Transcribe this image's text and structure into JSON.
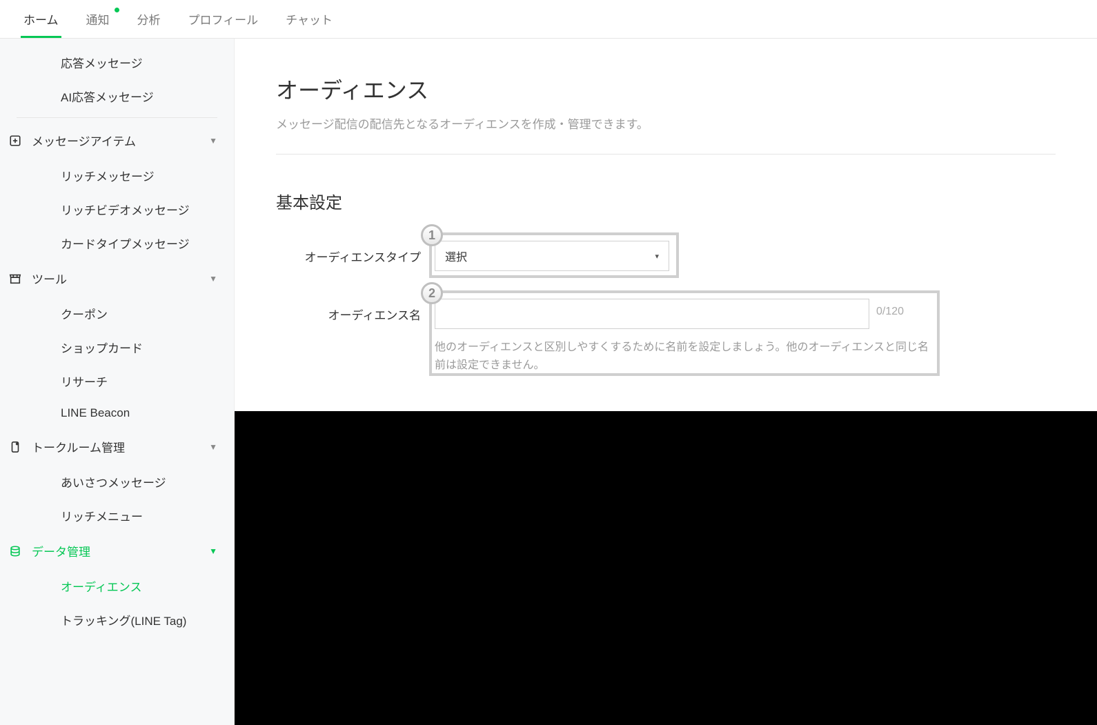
{
  "tabs": {
    "home": "ホーム",
    "notifications": "通知",
    "analytics": "分析",
    "profile": "プロフィール",
    "chat": "チャット"
  },
  "sidebar": {
    "reply_msg": "応答メッセージ",
    "ai_reply_msg": "AI応答メッセージ",
    "message_item": "メッセージアイテム",
    "rich_msg": "リッチメッセージ",
    "rich_video_msg": "リッチビデオメッセージ",
    "card_type_msg": "カードタイプメッセージ",
    "tools": "ツール",
    "coupon": "クーポン",
    "shop_card": "ショップカード",
    "research": "リサーチ",
    "line_beacon": "LINE Beacon",
    "talkroom_mgmt": "トークルーム管理",
    "greeting_msg": "あいさつメッセージ",
    "rich_menu": "リッチメニュー",
    "data_mgmt": "データ管理",
    "audience": "オーディエンス",
    "tracking": "トラッキング(LINE Tag)"
  },
  "main": {
    "title": "オーディエンス",
    "desc": "メッセージ配信の配信先となるオーディエンスを作成・管理できます。",
    "section": "基本設定",
    "type_label": "オーディエンスタイプ",
    "type_placeholder": "選択",
    "name_label": "オーディエンス名",
    "name_counter": "0/120",
    "name_help": "他のオーディエンスと区別しやすくするために名前を設定しましょう。他のオーディエンスと同じ名前は設定できません。"
  },
  "callouts": {
    "one": "1",
    "two": "2"
  }
}
